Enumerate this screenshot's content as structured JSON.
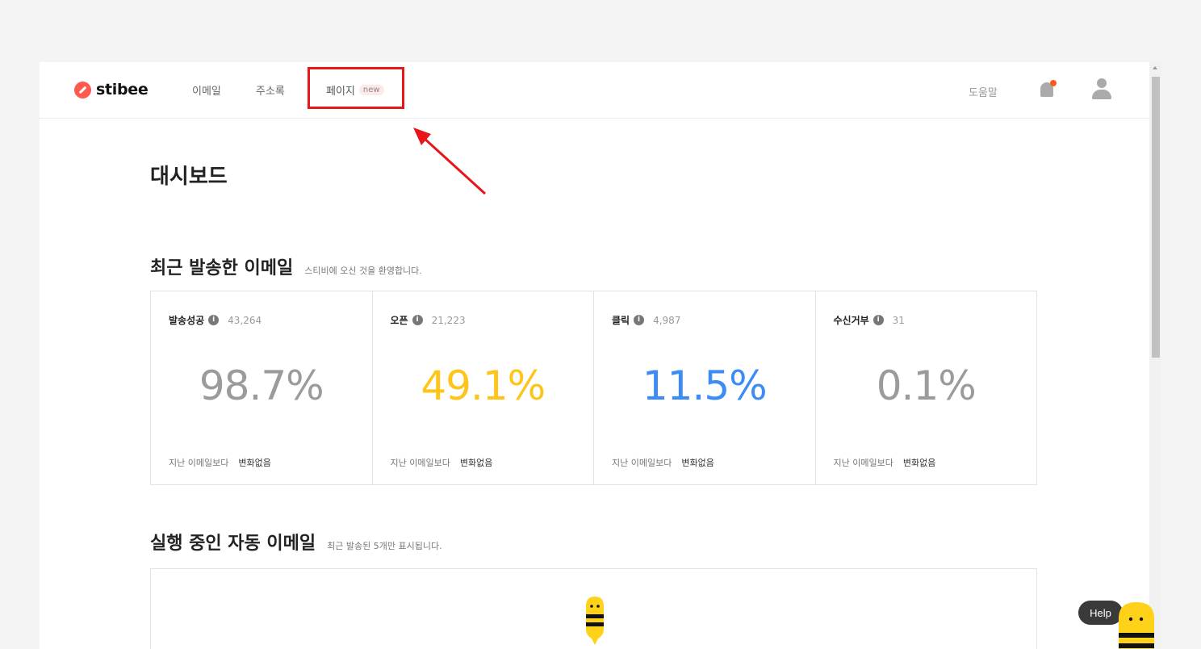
{
  "nav": {
    "logo": "stibee",
    "items": [
      {
        "label": "이메일"
      },
      {
        "label": "주소록"
      },
      {
        "label": "페이지",
        "badge": "new"
      }
    ],
    "help": "도움말"
  },
  "page": {
    "title": "대시보드"
  },
  "recent": {
    "title": "최근 발송한 이메일",
    "subtitle": "스티비에 오신 것을 환영합니다.",
    "stats": [
      {
        "label": "발송성공",
        "count": "43,264",
        "value": "98.7%",
        "color": "#9b9b9b",
        "foot": "지난 이메일보다",
        "change": "변화없음"
      },
      {
        "label": "오픈",
        "count": "21,223",
        "value": "49.1%",
        "color": "#ffc41a",
        "foot": "지난 이메일보다",
        "change": "변화없음"
      },
      {
        "label": "클릭",
        "count": "4,987",
        "value": "11.5%",
        "color": "#3d8bf5",
        "foot": "지난 이메일보다",
        "change": "변화없음"
      },
      {
        "label": "수신거부",
        "count": "31",
        "value": "0.1%",
        "color": "#9b9b9b",
        "foot": "지난 이메일보다",
        "change": "변화없음"
      }
    ]
  },
  "auto": {
    "title": "실행 중인 자동 이메일",
    "subtitle": "최근 발송된 5개만 표시됩니다."
  },
  "help_widget": {
    "label": "Help"
  },
  "colors": {
    "brand": "#ff5a4e",
    "highlight": "#e8161b",
    "bee_yellow": "#ffd21a"
  }
}
